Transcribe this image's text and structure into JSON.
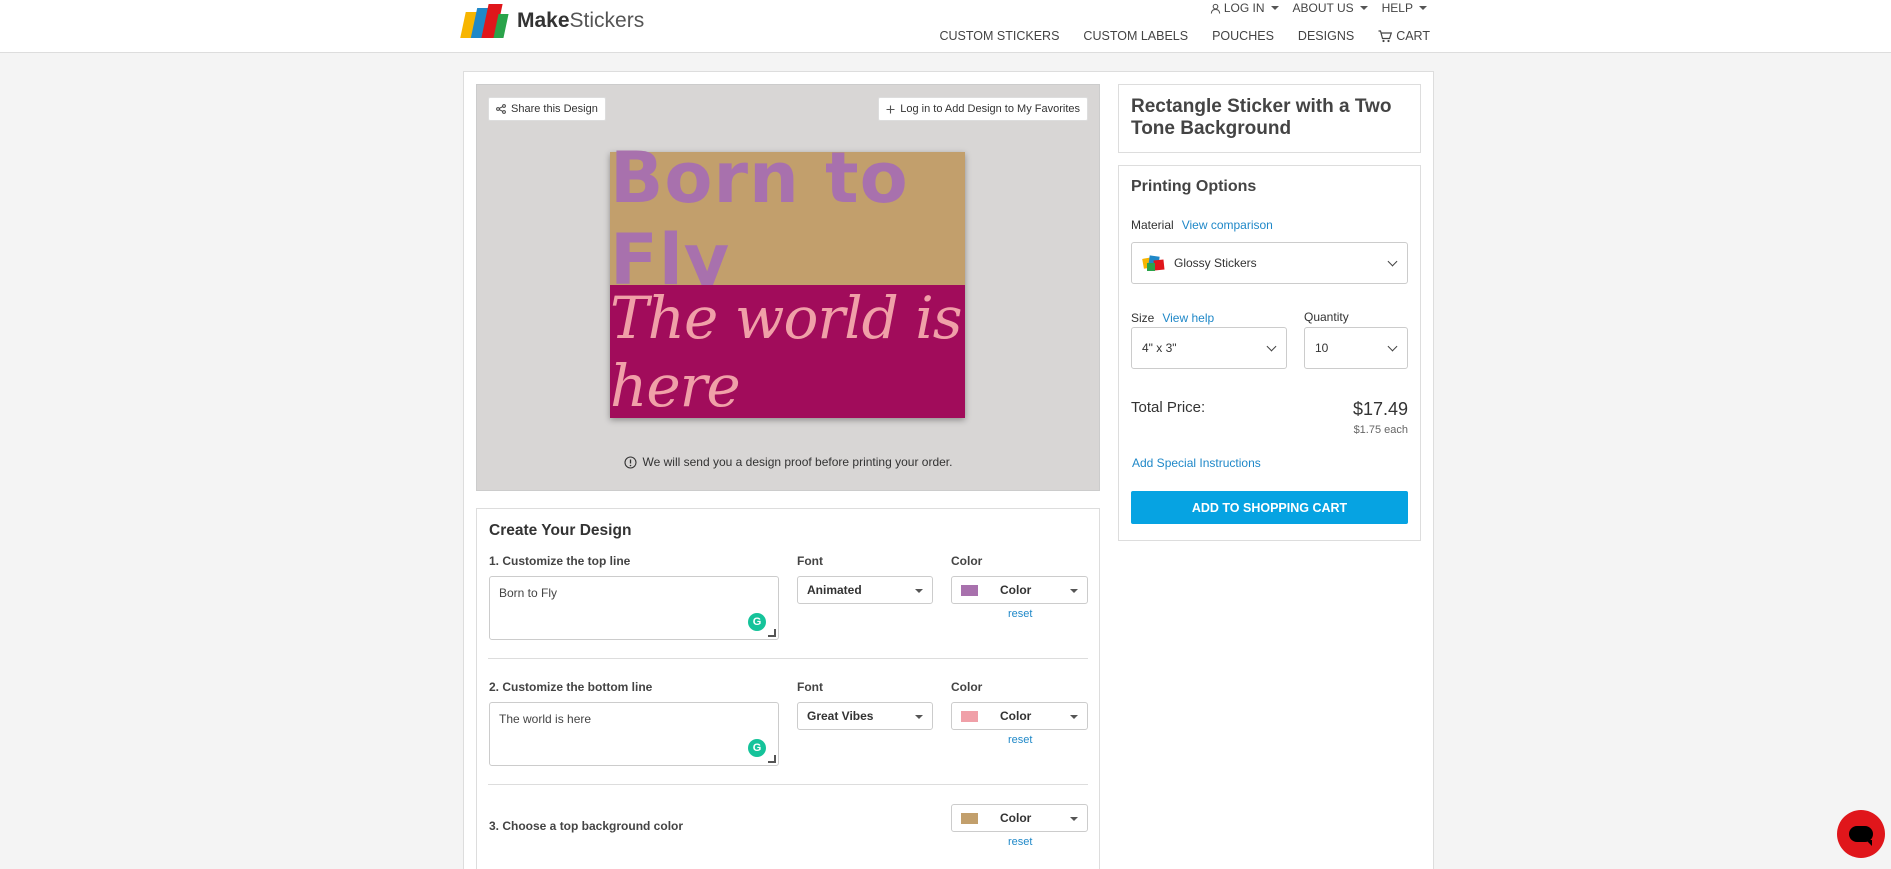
{
  "header": {
    "logo_bold": "Make",
    "logo_light": "Stickers",
    "top_nav": [
      {
        "label": "LOG IN"
      },
      {
        "label": "ABOUT US"
      },
      {
        "label": "HELP"
      }
    ],
    "main_nav": [
      {
        "label": "CUSTOM STICKERS"
      },
      {
        "label": "CUSTOM LABELS"
      },
      {
        "label": "POUCHES"
      },
      {
        "label": "DESIGNS"
      },
      {
        "label": "CART"
      }
    ]
  },
  "preview": {
    "share_label": "Share this Design",
    "favorite_label": "Log in to Add Design to My Favorites",
    "top_text": "Born to Fly",
    "bottom_text": "The world is here",
    "proof_note": "We will send you a design proof before printing your order.",
    "colors": {
      "top_bg": "#c29f6c",
      "top_text": "#a871ad",
      "bottom_bg": "#a10c5b",
      "bottom_text": "#f0a0a8"
    }
  },
  "design": {
    "title": "Create Your Design",
    "font_label": "Font",
    "color_label": "Color",
    "top_line": {
      "label": "1. Customize the top line",
      "value": "Born to Fly",
      "font": "Animated",
      "color_text": "Color",
      "swatch": "#a871ad",
      "reset": "reset"
    },
    "bottom_line": {
      "label": "2. Customize the bottom line",
      "value": "The world is here",
      "font": "Great Vibes",
      "color_text": "Color",
      "swatch": "#f0a0a8",
      "reset": "reset"
    },
    "top_bg": {
      "label": "3. Choose a top background color",
      "color_text": "Color",
      "swatch": "#c29f6c",
      "reset": "reset"
    }
  },
  "product": {
    "title": "Rectangle Sticker with a Two Tone Background"
  },
  "options": {
    "heading": "Printing Options",
    "material_label": "Material",
    "material_link": "View comparison",
    "material_value": "Glossy Stickers",
    "size_label": "Size",
    "size_link": "View help",
    "size_value": "4\" x 3\"",
    "quantity_label": "Quantity",
    "quantity_value": "10",
    "total_label": "Total Price:",
    "total_value": "$17.49",
    "each_value": "$1.75 each",
    "special_instructions": "Add Special Instructions",
    "add_to_cart": "ADD TO SHOPPING CART"
  }
}
